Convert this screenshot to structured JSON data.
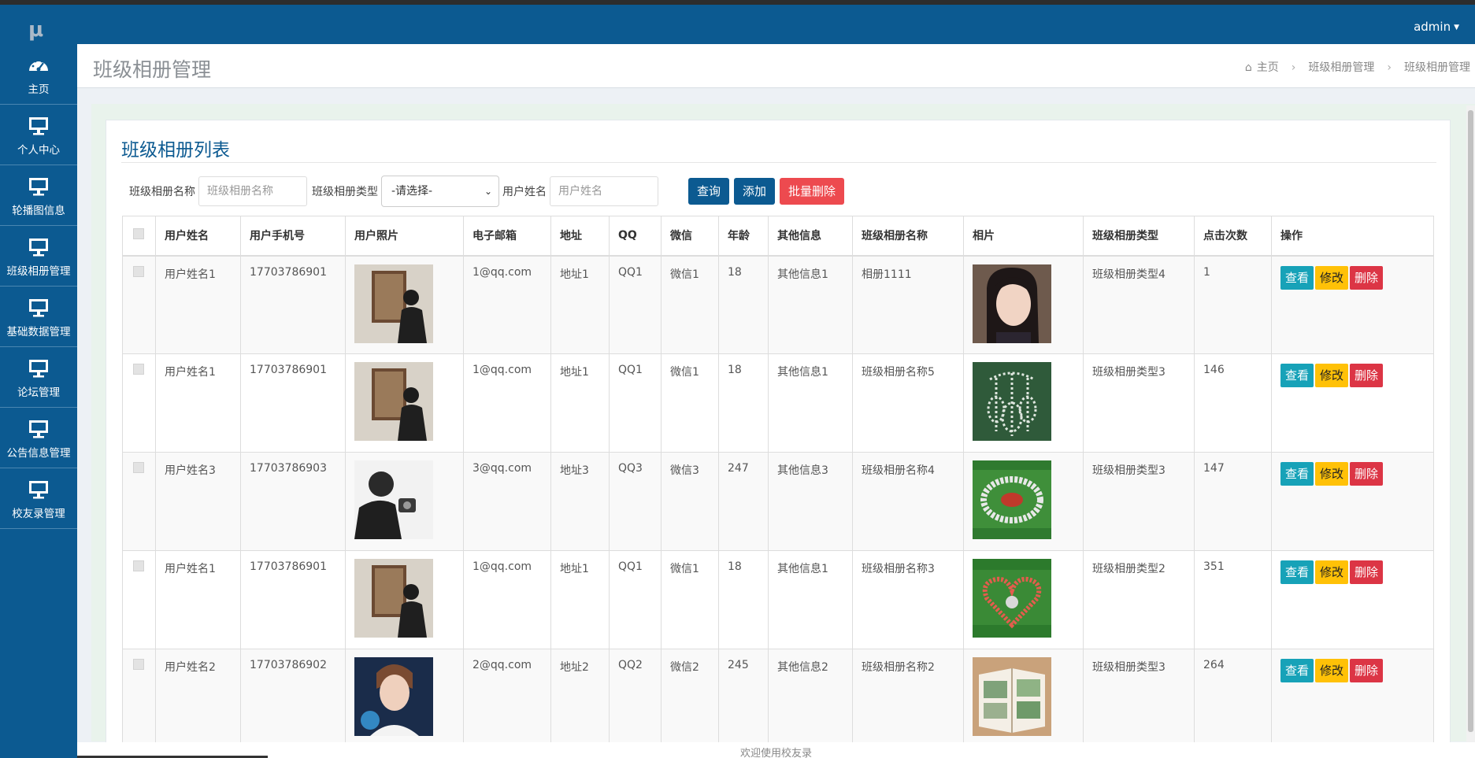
{
  "app": {
    "logo_text": "μ",
    "user_label": "admin"
  },
  "sidebar": {
    "items": [
      {
        "label": "主页",
        "icon": "dashboard-icon"
      },
      {
        "label": "个人中心",
        "icon": "monitor-icon"
      },
      {
        "label": "轮播图信息",
        "icon": "monitor-icon"
      },
      {
        "label": "班级相册管理",
        "icon": "monitor-icon"
      },
      {
        "label": "基础数据管理",
        "icon": "monitor-icon"
      },
      {
        "label": "论坛管理",
        "icon": "monitor-icon"
      },
      {
        "label": "公告信息管理",
        "icon": "monitor-icon"
      },
      {
        "label": "校友录管理",
        "icon": "monitor-icon"
      }
    ]
  },
  "header": {
    "title": "班级相册管理",
    "breadcrumb": [
      "主页",
      "班级相册管理",
      "班级相册管理"
    ]
  },
  "card": {
    "title": "班级相册列表"
  },
  "filters": {
    "album_name_label": "班级相册名称",
    "album_name_placeholder": "班级相册名称",
    "album_type_label": "班级相册类型",
    "album_type_value": "-请选择-",
    "user_name_label": "用户姓名",
    "user_name_placeholder": "用户姓名",
    "search_btn": "查询",
    "add_btn": "添加",
    "batch_delete_btn": "批量删除"
  },
  "table": {
    "columns": [
      "用户姓名",
      "用户手机号",
      "用户照片",
      "电子邮箱",
      "地址",
      "QQ",
      "微信",
      "年龄",
      "其他信息",
      "班级相册名称",
      "相片",
      "班级相册类型",
      "点击次数",
      "操作"
    ],
    "actions": {
      "view": "查看",
      "edit": "修改",
      "delete": "删除"
    },
    "rows": [
      {
        "name": "用户姓名1",
        "phone": "17703786901",
        "photo": "user-photo-1",
        "email": "1@qq.com",
        "address": "地址1",
        "qq": "QQ1",
        "wechat": "微信1",
        "age": "18",
        "other": "其他信息1",
        "album_name": "相册1111",
        "pic": "album-photo-portrait",
        "album_type": "班级相册类型4",
        "clicks": "1"
      },
      {
        "name": "用户姓名1",
        "phone": "17703786901",
        "photo": "user-photo-1",
        "email": "1@qq.com",
        "address": "地址1",
        "qq": "QQ1",
        "wechat": "微信1",
        "age": "18",
        "other": "其他信息1",
        "album_name": "班级相册名称5",
        "pic": "album-photo-formation",
        "album_type": "班级相册类型3",
        "clicks": "146"
      },
      {
        "name": "用户姓名3",
        "phone": "17703786903",
        "photo": "user-photo-3",
        "email": "3@qq.com",
        "address": "地址3",
        "qq": "QQ3",
        "wechat": "微信3",
        "age": "247",
        "other": "其他信息3",
        "album_name": "班级相册名称4",
        "pic": "album-photo-circle",
        "album_type": "班级相册类型3",
        "clicks": "147"
      },
      {
        "name": "用户姓名1",
        "phone": "17703786901",
        "photo": "user-photo-1",
        "email": "1@qq.com",
        "address": "地址1",
        "qq": "QQ1",
        "wechat": "微信1",
        "age": "18",
        "other": "其他信息1",
        "album_name": "班级相册名称3",
        "pic": "album-photo-heart",
        "album_type": "班级相册类型2",
        "clicks": "351"
      },
      {
        "name": "用户姓名2",
        "phone": "17703786902",
        "photo": "user-photo-2",
        "email": "2@qq.com",
        "address": "地址2",
        "qq": "QQ2",
        "wechat": "微信2",
        "age": "245",
        "other": "其他信息2",
        "album_name": "班级相册名称2",
        "pic": "album-photo-book",
        "album_type": "班级相册类型3",
        "clicks": "264"
      }
    ]
  },
  "footer": {
    "text": "欢迎使用校友录"
  },
  "colors": {
    "primary": "#0c5a91",
    "view": "#17a2b8",
    "edit": "#ffc107",
    "delete": "#dc3545",
    "batch_delete": "#ed4a4f"
  }
}
